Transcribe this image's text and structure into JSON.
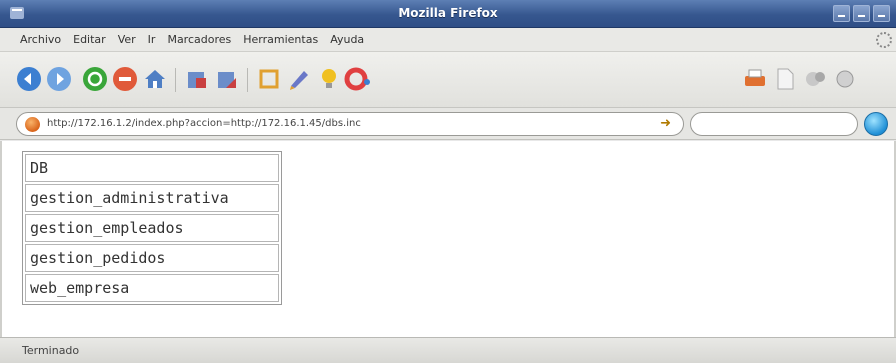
{
  "window": {
    "title": "Mozilla Firefox"
  },
  "menu": [
    "Archivo",
    "Editar",
    "Ver",
    "Ir",
    "Marcadores",
    "Herramientas",
    "Ayuda"
  ],
  "toolbar_icons": [
    {
      "name": "back-icon",
      "color": "#3c7fd1"
    },
    {
      "name": "forward-icon",
      "color": "#6fa3e0"
    },
    {
      "name": "reload-icon",
      "color": "#3aa63a"
    },
    {
      "name": "stop-icon",
      "color": "#e05a3a"
    },
    {
      "name": "home-icon",
      "color": "#4f7fc4"
    },
    {
      "name": "bookmarks-icon",
      "color": "#c94040"
    },
    {
      "name": "history-icon",
      "color": "#c94040"
    },
    {
      "name": "extension-icon",
      "color": "#e0a030"
    },
    {
      "name": "edit-icon",
      "color": "#6a78c8"
    },
    {
      "name": "bulb-icon",
      "color": "#f0c020"
    },
    {
      "name": "lifebuoy-icon",
      "color": "#e04040"
    },
    {
      "name": "print-icon",
      "color": "#e07030"
    },
    {
      "name": "page-icon",
      "color": "#d0d0d0"
    },
    {
      "name": "tools-icon",
      "color": "#b0b0b0"
    },
    {
      "name": "settings-icon",
      "color": "#c0c0c0"
    }
  ],
  "address_bar": {
    "url": "http://172.16.1.2/index.php?accion=http://172.16.1.45/dbs.inc"
  },
  "search": {
    "placeholder": ""
  },
  "table": {
    "rows": [
      "DB",
      "gestion_administrativa",
      "gestion_empleados",
      "gestion_pedidos",
      "web_empresa"
    ]
  },
  "status": {
    "text": "Terminado"
  }
}
